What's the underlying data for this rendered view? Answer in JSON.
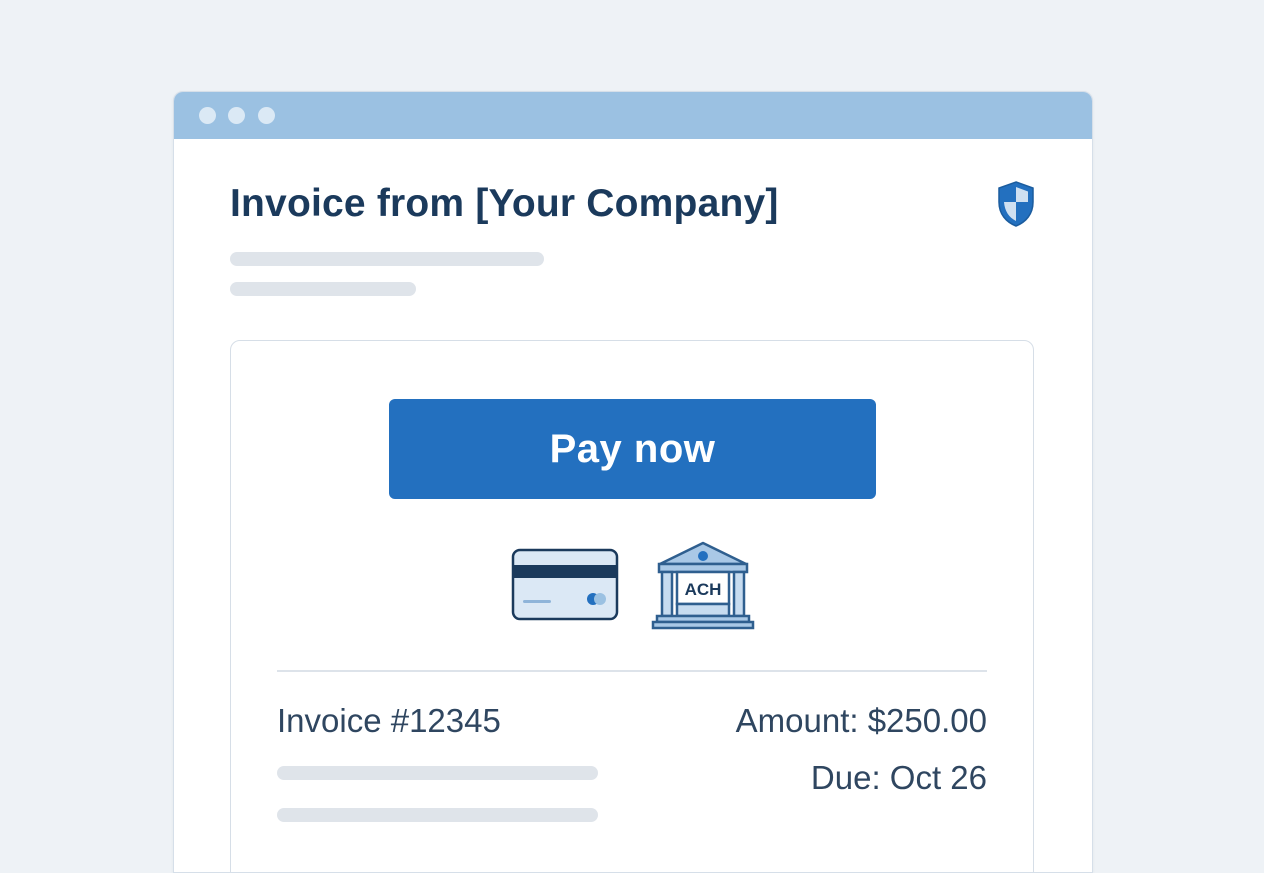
{
  "window": {
    "controls": [
      "close-dot",
      "minimize-dot",
      "maximize-dot"
    ]
  },
  "email": {
    "heading": "Invoice from [Your Company]",
    "security_icon": "shield-icon"
  },
  "payment": {
    "button_label": "Pay now",
    "methods": [
      {
        "name": "credit-card-icon",
        "label": ""
      },
      {
        "name": "bank-icon",
        "label": "ACH"
      }
    ]
  },
  "invoice": {
    "number": "Invoice #12345",
    "amount": "Amount: $250.00",
    "due": "Due: Oct 26"
  },
  "colors": {
    "accent": "#2370bf",
    "titlebar": "#9bc1e2",
    "heading": "#1b3a5c",
    "body_text": "#2f4660",
    "background": "#eef2f6",
    "skeleton": "#dfe4ea"
  }
}
